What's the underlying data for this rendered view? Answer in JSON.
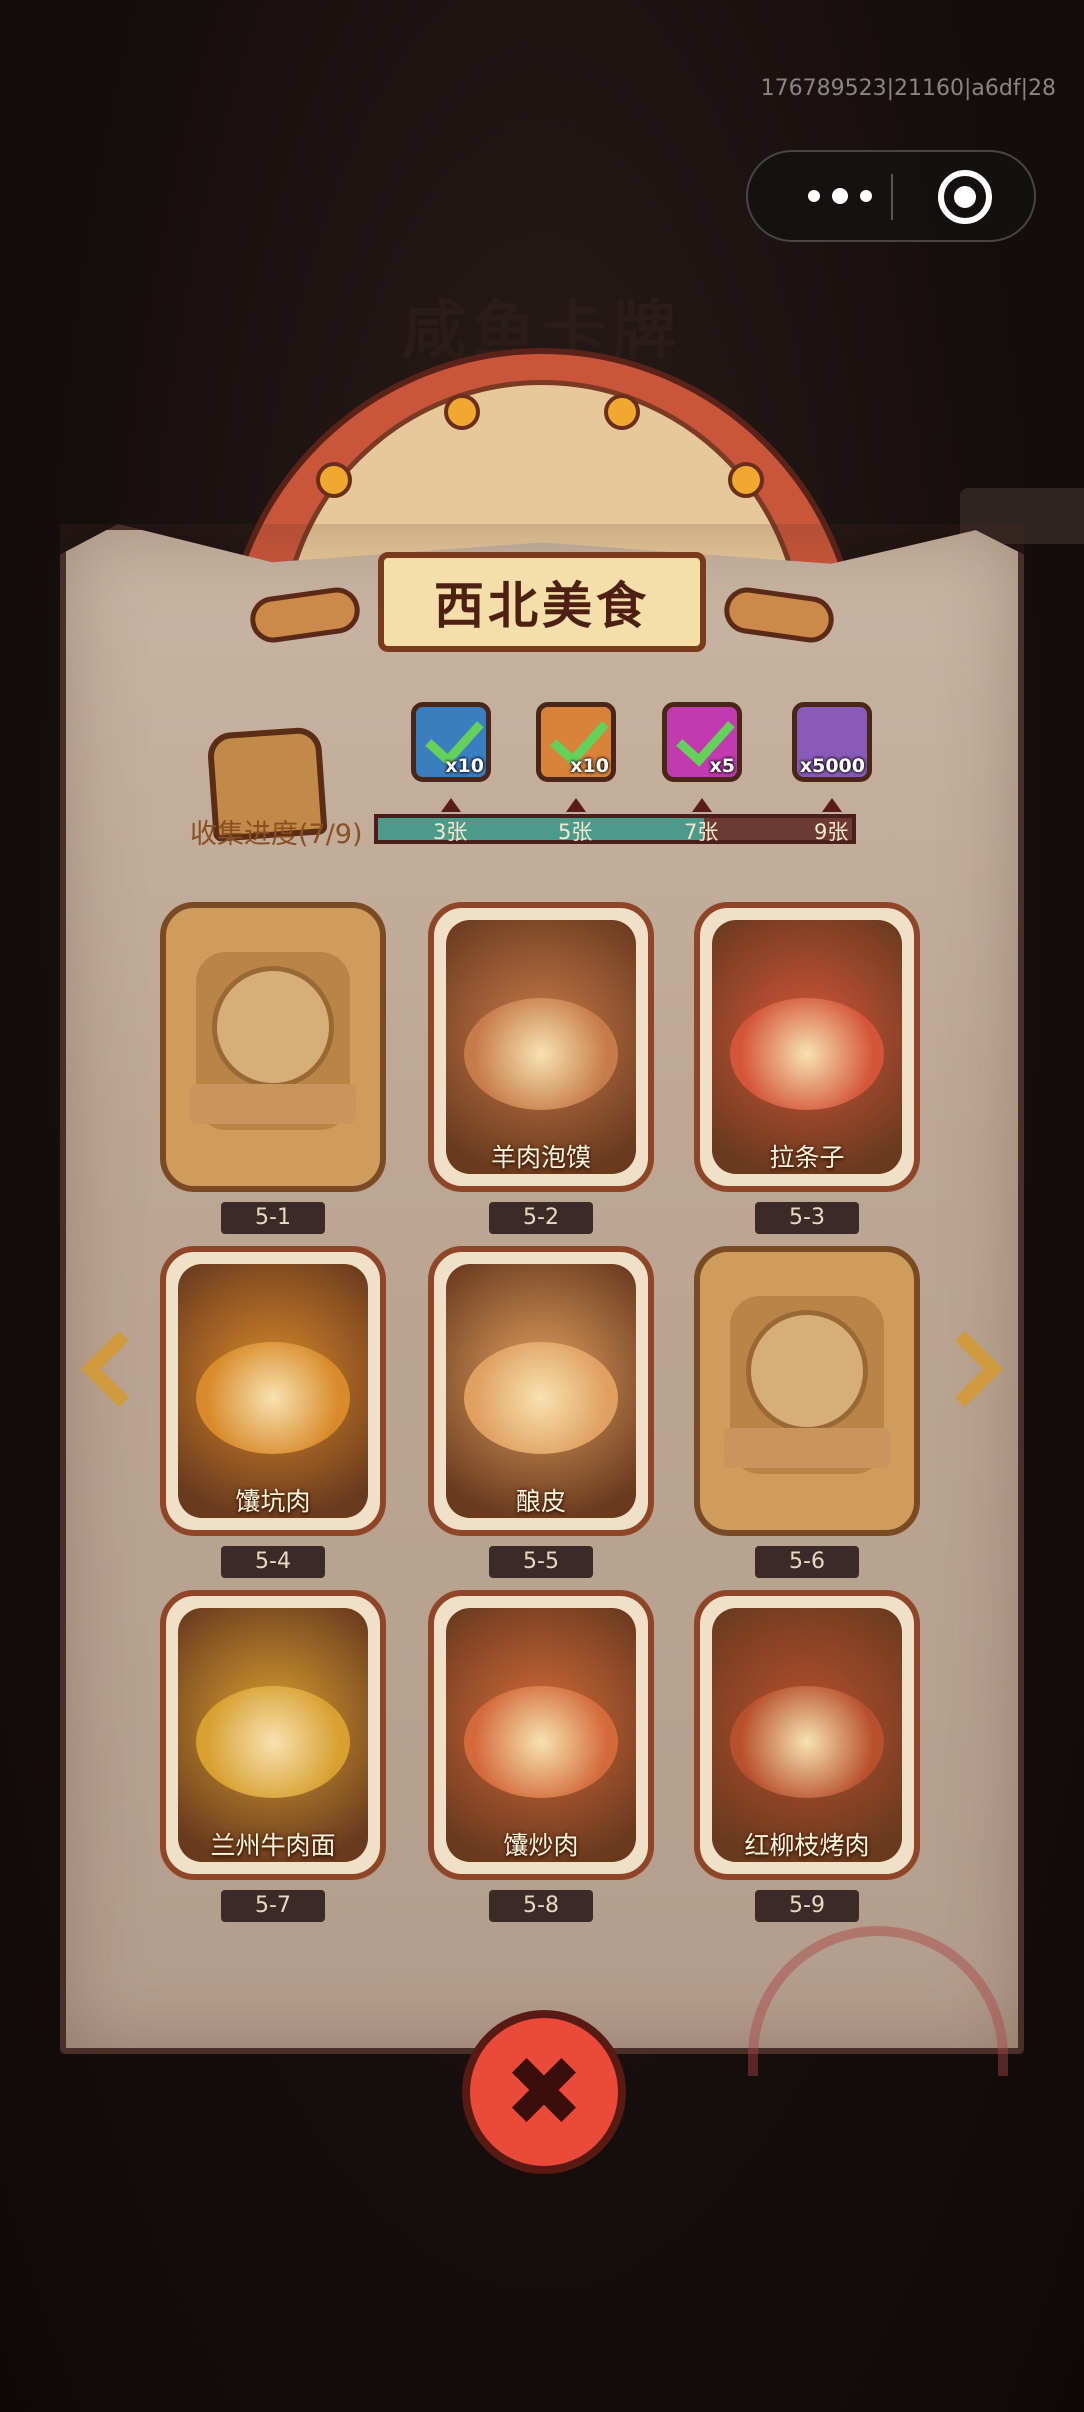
{
  "debug_id": "176789523|21160|a6df|28",
  "menu": {
    "more_icon": "more-icon",
    "close_icon": "target-icon"
  },
  "background": {
    "title": "咸鱼卡牌"
  },
  "panel": {
    "title": "西北美食"
  },
  "progress": {
    "label": "收集进度(7/9)",
    "collected": 7,
    "total": 9,
    "rewards": [
      {
        "icon": "bag-icon",
        "quantity": "x10",
        "color": "#3a7ec0",
        "claimed": true
      },
      {
        "icon": "ticket-icon",
        "quantity": "x10",
        "color": "#d9823a",
        "claimed": true
      },
      {
        "icon": "orb-icon",
        "quantity": "x5",
        "color": "#c23ab0",
        "claimed": true
      },
      {
        "icon": "crystal-icon",
        "quantity": "x5000",
        "color": "#8a5ab8",
        "claimed": false
      }
    ],
    "milestones": [
      "3张",
      "5张",
      "7张",
      "9张"
    ]
  },
  "cards": [
    {
      "code": "5-1",
      "name": "",
      "collected": false
    },
    {
      "code": "5-2",
      "name": "羊肉泡馍",
      "collected": true,
      "color": "#c77b4a"
    },
    {
      "code": "5-3",
      "name": "拉条子",
      "collected": true,
      "color": "#d4553a"
    },
    {
      "code": "5-4",
      "name": "馕坑肉",
      "collected": true,
      "color": "#d98a2a"
    },
    {
      "code": "5-5",
      "name": "酿皮",
      "collected": true,
      "color": "#e0a060"
    },
    {
      "code": "5-6",
      "name": "",
      "collected": false
    },
    {
      "code": "5-7",
      "name": "兰州牛肉面",
      "collected": true,
      "color": "#d8a030"
    },
    {
      "code": "5-8",
      "name": "馕炒肉",
      "collected": true,
      "color": "#d46a3a"
    },
    {
      "code": "5-9",
      "name": "红柳枝烤肉",
      "collected": true,
      "color": "#b8502e"
    }
  ],
  "nav": {
    "prev_icon": "chevron-left-icon",
    "next_icon": "chevron-right-icon"
  },
  "close_button": {
    "icon": "close-icon"
  }
}
